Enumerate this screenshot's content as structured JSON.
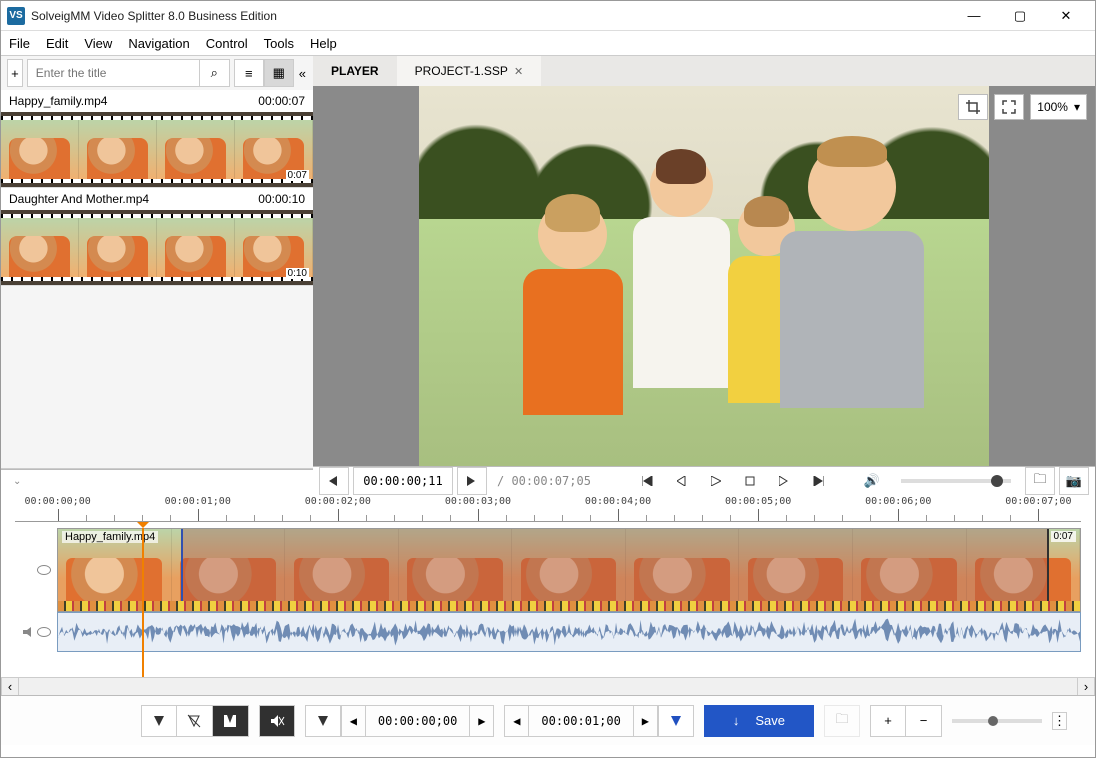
{
  "title": "SolveigMM Video Splitter 8.0 Business Edition",
  "logo_text": "VS",
  "menu": [
    "File",
    "Edit",
    "View",
    "Navigation",
    "Control",
    "Tools",
    "Help"
  ],
  "sidebar": {
    "search_placeholder": "Enter the title",
    "clips": [
      {
        "name": "Happy_family.mp4",
        "duration": "00:00:07",
        "extra": "0:07"
      },
      {
        "name": "Daughter And Mother.mp4",
        "duration": "00:00:10",
        "extra": "0:10"
      }
    ]
  },
  "tabs": [
    {
      "label": "PLAYER",
      "active": true
    },
    {
      "label": "PROJECT-1.SSP",
      "active": false,
      "closable": true
    }
  ],
  "overlay": {
    "zoom_label": "100%",
    "crop_icon": "crop-icon",
    "fullscreen_icon": "fullscreen-icon"
  },
  "player": {
    "current_time": "00:00:00;11",
    "total_time": "00:00:07;05"
  },
  "ruler": {
    "labels": [
      "00:00:00;00",
      "00:00:01;00",
      "00:00:02;00",
      "00:00:03;00",
      "00:00:04;00",
      "00:00:05;00",
      "00:00:06;00",
      "00:00:07;00"
    ]
  },
  "timeline": {
    "clip_label": "Happy_family.mp4",
    "clip_time": "0:07",
    "selection_start_pct": 12,
    "selection_end_pct": 97,
    "playhead_pct": 9
  },
  "bottom": {
    "left_time": "00:00:00;00",
    "right_time": "00:00:01;00",
    "save_label": "Save"
  },
  "icons": {
    "plus": "+",
    "search": "⌕",
    "list": "≡",
    "grid": "▦",
    "min": "—",
    "max": "▢",
    "close": "✕",
    "play": "▶",
    "prev": "◀",
    "stepb": "⏮",
    "skipb": "⏪",
    "stop": "■",
    "stepf": "⏭",
    "skipf": "⏩",
    "jstart": "⏮|",
    "jend": "|⏭",
    "vol": "🔊",
    "cam": "📷",
    "folder": "🗀",
    "marker": "▼",
    "marker_off": "▽",
    "cut": "✂",
    "mute_strike": "🔇",
    "down": "↓",
    "dots": "⋮",
    "chev_l": "‹",
    "chev_r": "›",
    "chev_d": "⌄",
    "collapse": "«"
  }
}
